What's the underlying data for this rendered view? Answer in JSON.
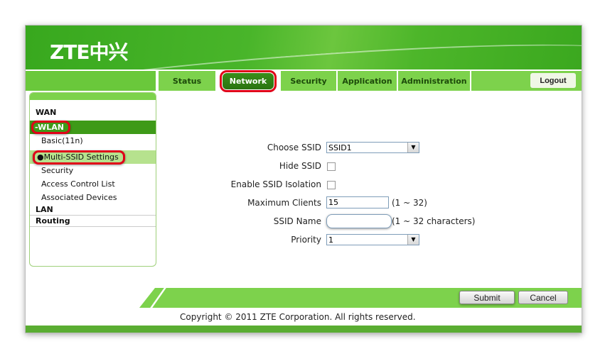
{
  "header": {
    "logo": "ZTE中兴"
  },
  "nav": {
    "tabs": [
      {
        "label": "Status"
      },
      {
        "label": "Network",
        "active": true
      },
      {
        "label": "Security"
      },
      {
        "label": "Application"
      },
      {
        "label": "Administration"
      }
    ],
    "logout": "Logout"
  },
  "sidebar": {
    "wan": "WAN",
    "wlan": "-WLAN",
    "basic": "Basic(11n)",
    "multi_ssid": "Multi-SSID Settings",
    "security": "Security",
    "acl": "Access Control List",
    "associated": "Associated Devices",
    "lan": "LAN",
    "routing": "Routing"
  },
  "form": {
    "choose_ssid_label": "Choose SSID",
    "choose_ssid_value": "SSID1",
    "hide_ssid_label": "Hide SSID",
    "hide_ssid_checked": false,
    "isolation_label": "Enable SSID Isolation",
    "isolation_checked": false,
    "max_clients_label": "Maximum Clients",
    "max_clients_value": "15",
    "max_clients_hint": "(1 ~ 32)",
    "ssid_name_label": "SSID Name",
    "ssid_name_value": "",
    "ssid_name_hint": "(1 ~ 32 characters)",
    "priority_label": "Priority",
    "priority_value": "1"
  },
  "buttons": {
    "submit": "Submit",
    "cancel": "Cancel"
  },
  "footer": {
    "copyright": "Copyright © 2011 ZTE Corporation. All rights reserved."
  }
}
